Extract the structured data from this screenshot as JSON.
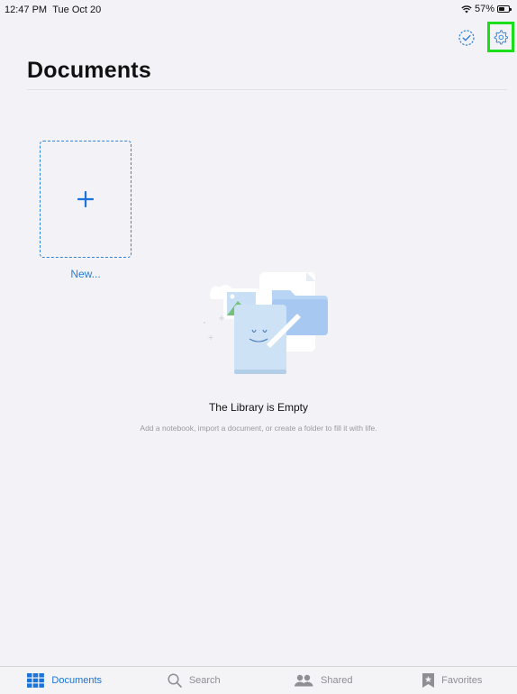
{
  "status_bar": {
    "time": "12:47 PM",
    "date": "Tue Oct 20",
    "battery": "57%",
    "battery_level": 0.57,
    "icons": [
      "wifi-icon",
      "battery-icon"
    ]
  },
  "toolbar": {
    "icons": [
      "select-checkmark-icon",
      "gear-icon"
    ]
  },
  "header": {
    "title": "Documents"
  },
  "grid": {
    "new_label": "New..."
  },
  "empty_state": {
    "title": "The Library is Empty",
    "subtitle": "Add a notebook, import a document, or create a folder to fill it with life."
  },
  "tab_bar": {
    "tabs": [
      {
        "label": "Documents",
        "icon": "grid-icon",
        "active": true
      },
      {
        "label": "Search",
        "icon": "magnifier-icon",
        "active": false
      },
      {
        "label": "Shared",
        "icon": "people-icon",
        "active": false
      },
      {
        "label": "Favorites",
        "icon": "star-bookmark-icon",
        "active": false
      }
    ]
  },
  "colors": {
    "accent": "#1a73d8",
    "highlight": "#1adf1a",
    "background": "#f2f2f7"
  }
}
